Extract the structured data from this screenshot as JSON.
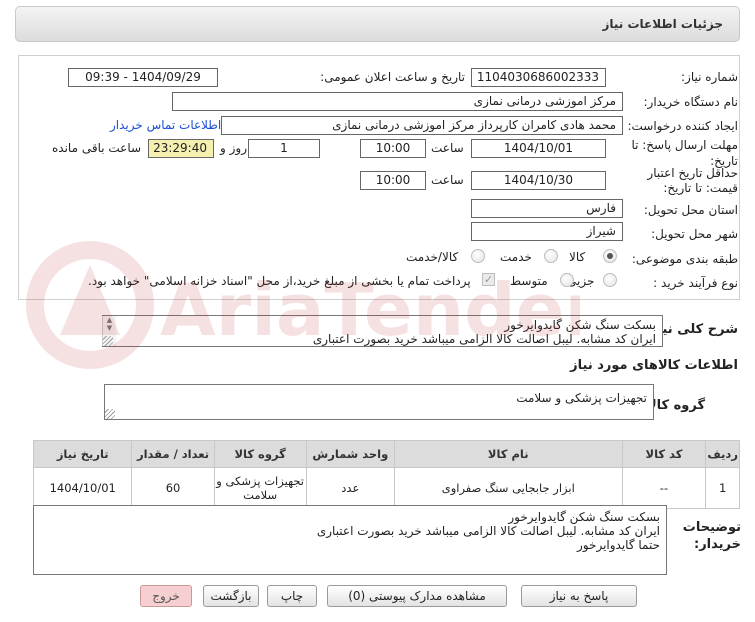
{
  "header": {
    "title": "جزئیات اطلاعات نیاز"
  },
  "labels": {
    "need_number": "شماره نیاز:",
    "announce_datetime": "تاریخ و ساعت اعلان عمومی:",
    "buyer_org": "نام دستگاه خریدار:",
    "requester": "ایجاد کننده درخواست:",
    "contact_link": "اطلاعات تماس خریدار",
    "reply_deadline": "مهلت ارسال پاسخ: تا تاریخ:",
    "min_validity": "حداقل تاریخ اعتبار قیمت: تا تاریخ:",
    "time": "ساعت",
    "day_and": "روز و",
    "time_remaining": "ساعت باقی مانده",
    "province": "استان محل تحویل:",
    "city": "شهر محل تحویل:",
    "category": "طبقه بندی موضوعی:",
    "process_type": "نوع فرآیند خرید :",
    "need_summary": "شرح کلی نیاز:",
    "goods_info": "اطلاعات کالاهای مورد نیاز",
    "goods_group": "گروه کالا:",
    "buyer_notes": "توضیحات خریدار:"
  },
  "values": {
    "need_number": "1104030686002333",
    "announce_datetime": "1404/09/29 - 09:39",
    "buyer_org": "مرکز اموزشی درمانی نمازی",
    "requester": "محمد هادی کامران کارپرداز مرکز اموزشی درمانی نمازی",
    "reply_date": "1404/10/01",
    "reply_time": "10:00",
    "days": "1",
    "remaining": "23:29:40",
    "validity_date": "1404/10/30",
    "validity_time": "10:00",
    "province": "فارس",
    "city": "شیراز",
    "goods_group": "تجهیزات پزشکی و سلامت",
    "need_summary": "بسکت سنگ شکن گایدوایرخور\nایران کد مشابه. لیبل اصالت کالا الزامی میباشد خرید بصورت اعتباری",
    "buyer_notes": "بسکت سنگ شکن گایدوایرخور\nایران کد مشابه. لیبل اصالت کالا الزامی میباشد خرید بصورت اعتباری\nحتما گایدوایرخور"
  },
  "category_options": [
    {
      "label": "کالا",
      "selected": true
    },
    {
      "label": "خدمت",
      "selected": false
    },
    {
      "label": "کالا/خدمت",
      "selected": false
    }
  ],
  "process_options": [
    {
      "label": "جزیی",
      "selected": false
    },
    {
      "label": "متوسط",
      "selected": false
    }
  ],
  "payment_note": "پرداخت تمام یا بخشی از مبلغ خرید،از محل \"اسناد خزانه اسلامی\" خواهد بود.",
  "table": {
    "headers": [
      "ردیف",
      "کد کالا",
      "نام کالا",
      "واحد شمارش",
      "گروه کالا",
      "تعداد / مقدار",
      "تاریخ نیاز"
    ],
    "rows": [
      [
        "1",
        "--",
        "ابزار جابجایی سنگ صفراوی",
        "عدد",
        "تجهیزات پزشکی و سلامت",
        "60",
        "1404/10/01"
      ]
    ]
  },
  "buttons": {
    "reply": "پاسخ به نیاز",
    "attachments": "مشاهده مدارک پیوستی (0)",
    "print": "چاپ",
    "back": "بازگشت",
    "exit": "خروج"
  },
  "watermark": "AriaTender.net",
  "colors": {
    "link": "#1a4fd6",
    "remaining_bg": "#f5efb0",
    "exit_bg": "#f6cfd0"
  }
}
